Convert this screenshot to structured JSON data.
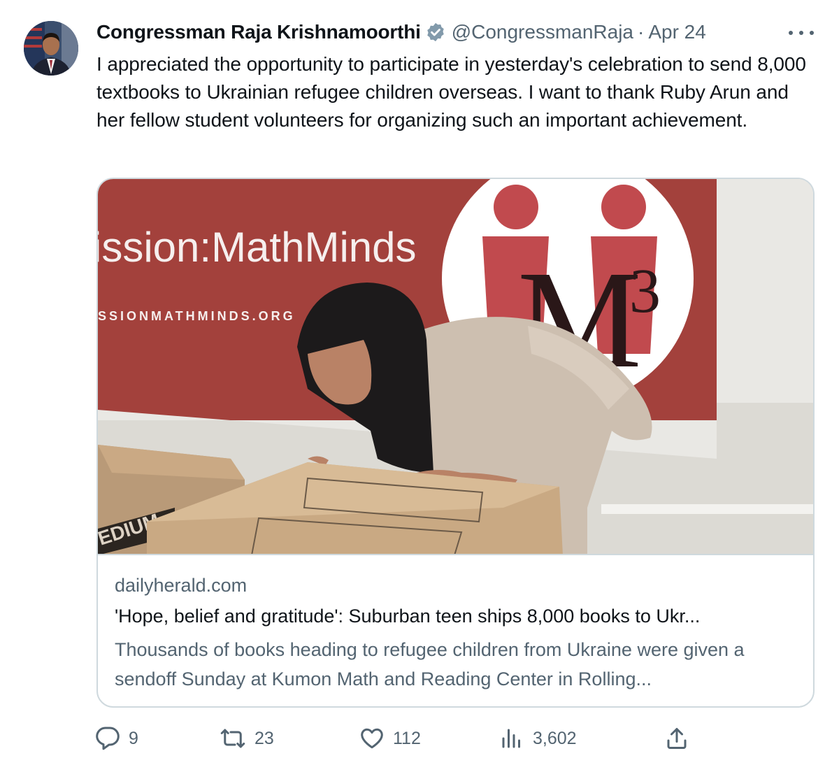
{
  "tweet": {
    "author_name": "Congressman Raja Krishnamoorthi",
    "handle": "@CongressmanRaja",
    "separator": "·",
    "date": "Apr 24",
    "text": "I appreciated the opportunity to participate in yesterday's celebration to send 8,000 textbooks to Ukrainian refugee children overseas. I want to thank Ruby Arun and her fellow student volunteers for organizing such an important achievement.",
    "verified": true
  },
  "card": {
    "image_banner_text": "ission:MathMinds",
    "image_banner_url": "SSIONMATHMINDS.ORG",
    "image_logo_text": "M",
    "image_logo_superscript": "3",
    "image_box_text": "EDIUM",
    "domain": "dailyherald.com",
    "title": "'Hope, belief and gratitude': Suburban teen ships 8,000 books to Ukr...",
    "description": "Thousands of books heading to refugee children from Ukraine were given a sendoff Sunday at Kumon Math and Reading Center in Rolling..."
  },
  "actions": {
    "replies": "9",
    "retweets": "23",
    "likes": "112",
    "views": "3,602"
  },
  "colors": {
    "text_primary": "#0f1419",
    "text_secondary": "#536471",
    "verified": "#829aab",
    "border": "#cfd9de",
    "banner_red": "#a3413c"
  },
  "icons": [
    "verified-badge-icon",
    "more-icon",
    "reply-icon",
    "retweet-icon",
    "like-icon",
    "views-icon",
    "share-icon"
  ]
}
